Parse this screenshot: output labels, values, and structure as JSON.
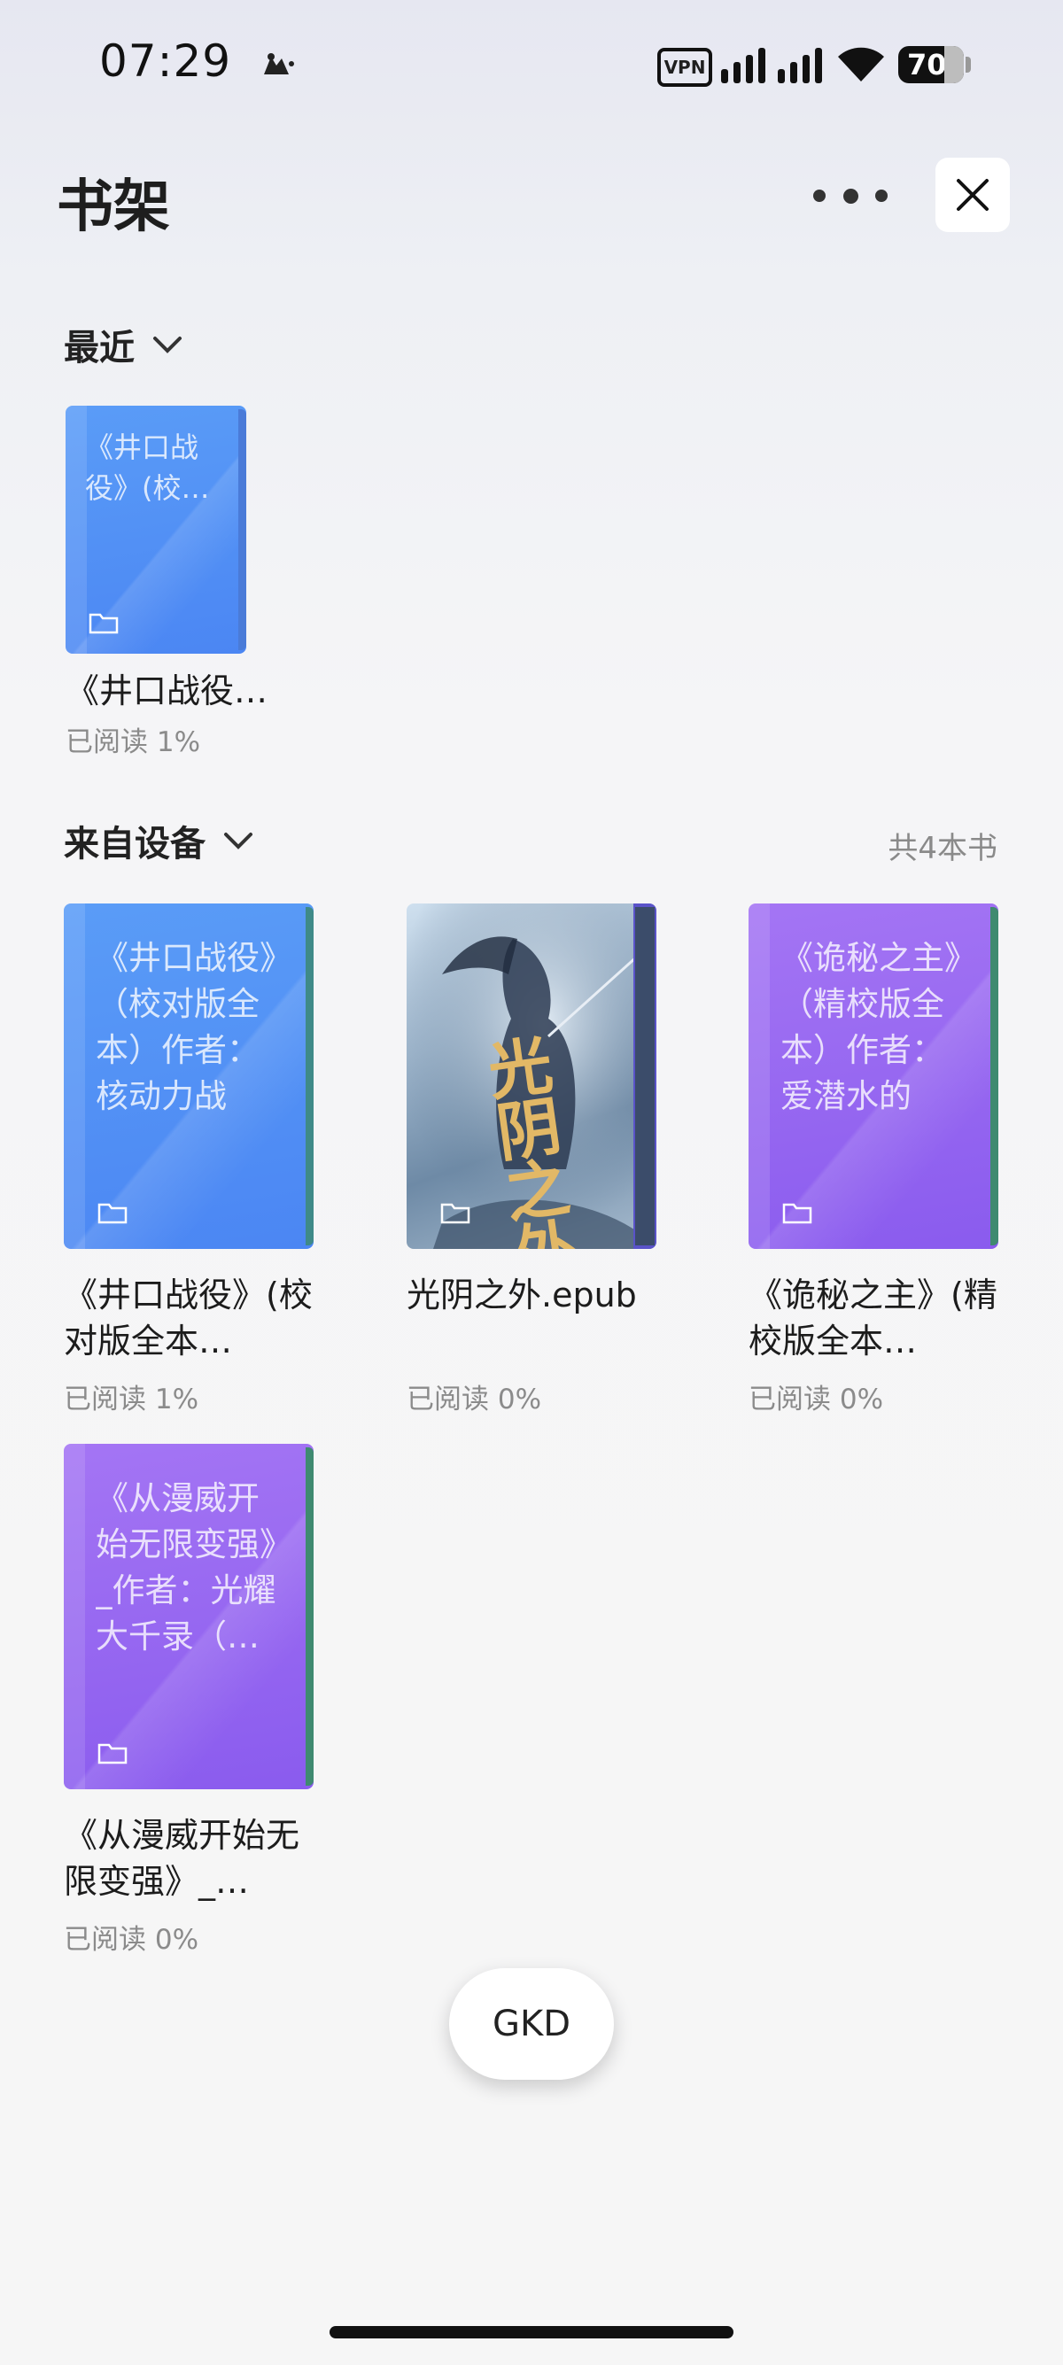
{
  "status_bar": {
    "time": "07:29",
    "vpn": "VPN",
    "battery": "70"
  },
  "header": {
    "title": "书架"
  },
  "recent": {
    "label": "最近",
    "books": [
      {
        "cover_text": "《井口战役》(校…",
        "title": "《井口战役…",
        "progress": "已阅读 1%",
        "color": "#5a9cf7"
      }
    ]
  },
  "device": {
    "label": "来自设备",
    "count": "共4本书",
    "books": [
      {
        "cover_text": "《井口战役》（校对版全本）作者：核动力战列…",
        "title": "《井口战役》(校对版全本…",
        "progress": "已阅读 1%",
        "color": "#5a9cf7"
      },
      {
        "cover_text": "",
        "cover_art": "光阴之外",
        "title": "光阴之外.epub",
        "progress": "已阅读 0%"
      },
      {
        "cover_text": "《诡秘之主》（精校版全本）作者：爱潜水的乌…",
        "title": "《诡秘之主》(精校版全本…",
        "progress": "已阅读 0%",
        "color": "#a475f4"
      },
      {
        "cover_text": "《从漫威开始无限变强》_作者：光耀大千录（…",
        "title": "《从漫威开始无限变强》_…",
        "progress": "已阅读 0%",
        "color": "#a475f4"
      }
    ]
  },
  "floating_button": {
    "label": "GKD"
  }
}
